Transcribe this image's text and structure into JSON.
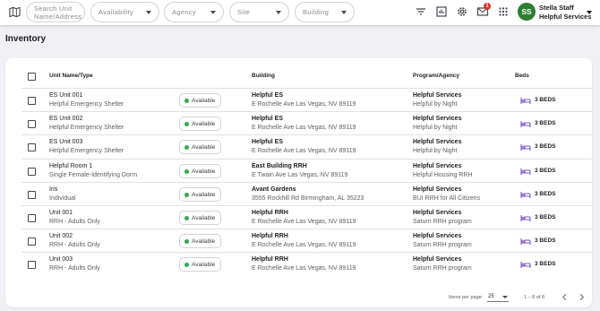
{
  "toolbar": {
    "filters": {
      "search_placeholder": "Search Unit Name/Address",
      "availability": "Availability",
      "agency": "Agency",
      "site": "Site",
      "building": "Building"
    },
    "notification_count": "1",
    "user": {
      "initials": "SS",
      "name": "Stella Staff",
      "organization": "Helpful Services"
    }
  },
  "page": {
    "title": "Inventory"
  },
  "table": {
    "headers": {
      "unit": "Unit Name/Type",
      "building": "Building",
      "program": "Program/Agency",
      "beds": "Beds"
    },
    "rows": [
      {
        "name": "ES Unit 001",
        "type": "Helpful Emergency Shelter",
        "status": "Available",
        "building": "Helpful ES",
        "address": "E Rochelle Ave Las Vegas, NV 89119",
        "agency": "Helpful Services",
        "program": "Helpful by Night",
        "beds": "3 BEDS"
      },
      {
        "name": "ES Unit 002",
        "type": "Helpful Emergency Shelter",
        "status": "Available",
        "building": "Helpful ES",
        "address": "E Rochelle Ave Las Vegas, NV 89119",
        "agency": "Helpful Services",
        "program": "Helpful by Night",
        "beds": "3 BEDS"
      },
      {
        "name": "ES Unit 003",
        "type": "Helpful Emergency Shelter",
        "status": "Available",
        "building": "Helpful ES",
        "address": "E Rochelle Ave Las Vegas, NV 89119",
        "agency": "Helpful Services",
        "program": "Helpful by Night",
        "beds": "3 BEDS"
      },
      {
        "name": "Helpful Room 1",
        "type": "Single Female-Identifying Dorm",
        "status": "Available",
        "building": "East Building RRH",
        "address": "E Twain Ave Las Vegas, NV 89119",
        "agency": "Helpful Services",
        "program": "Helpful Housing RRH",
        "beds": "3 BEDS"
      },
      {
        "name": "Iris",
        "type": "Individual",
        "status": "Available",
        "building": "Avant Gardens",
        "address": "3555 Rockhill Rd Birmingham, AL 35223",
        "agency": "Helpful Services",
        "program": "BUI RRH for All Citizens",
        "beds": "3 BEDS"
      },
      {
        "name": "Unit 001",
        "type": "RRH - Adults Only",
        "status": "Available",
        "building": "Helpful RRH",
        "address": "E Rochelle Ave Las Vegas, NV 89119",
        "agency": "Helpful Services",
        "program": "Saturn RRH program",
        "beds": "3 BEDS"
      },
      {
        "name": "Unit 002",
        "type": "RRH - Adults Only",
        "status": "Available",
        "building": "Helpful RRH",
        "address": "E Rochelle Ave Las Vegas, NV 89119",
        "agency": "Helpful Services",
        "program": "Saturn RRH program",
        "beds": "3 BEDS"
      },
      {
        "name": "Unit 003",
        "type": "RRH - Adults Only",
        "status": "Available",
        "building": "Helpful RRH",
        "address": "E Rochelle Ave Las Vegas, NV 89119",
        "agency": "Helpful Services",
        "program": "Saturn RRH program",
        "beds": "3 BEDS"
      }
    ]
  },
  "pagination": {
    "items_per_page_label": "Items per page:",
    "items_per_page": "25",
    "range": "1 – 8 of 8"
  },
  "colors": {
    "available_dot": "#34a853",
    "bed_icon": "#7e57c2",
    "avatar": "#2e7d32",
    "badge": "#d93025"
  },
  "icons": [
    "map-icon",
    "filter-icon",
    "report-icon",
    "gear-icon",
    "mail-icon",
    "apps-grid-icon",
    "bed-icon",
    "chevron-left-icon",
    "chevron-right-icon"
  ]
}
